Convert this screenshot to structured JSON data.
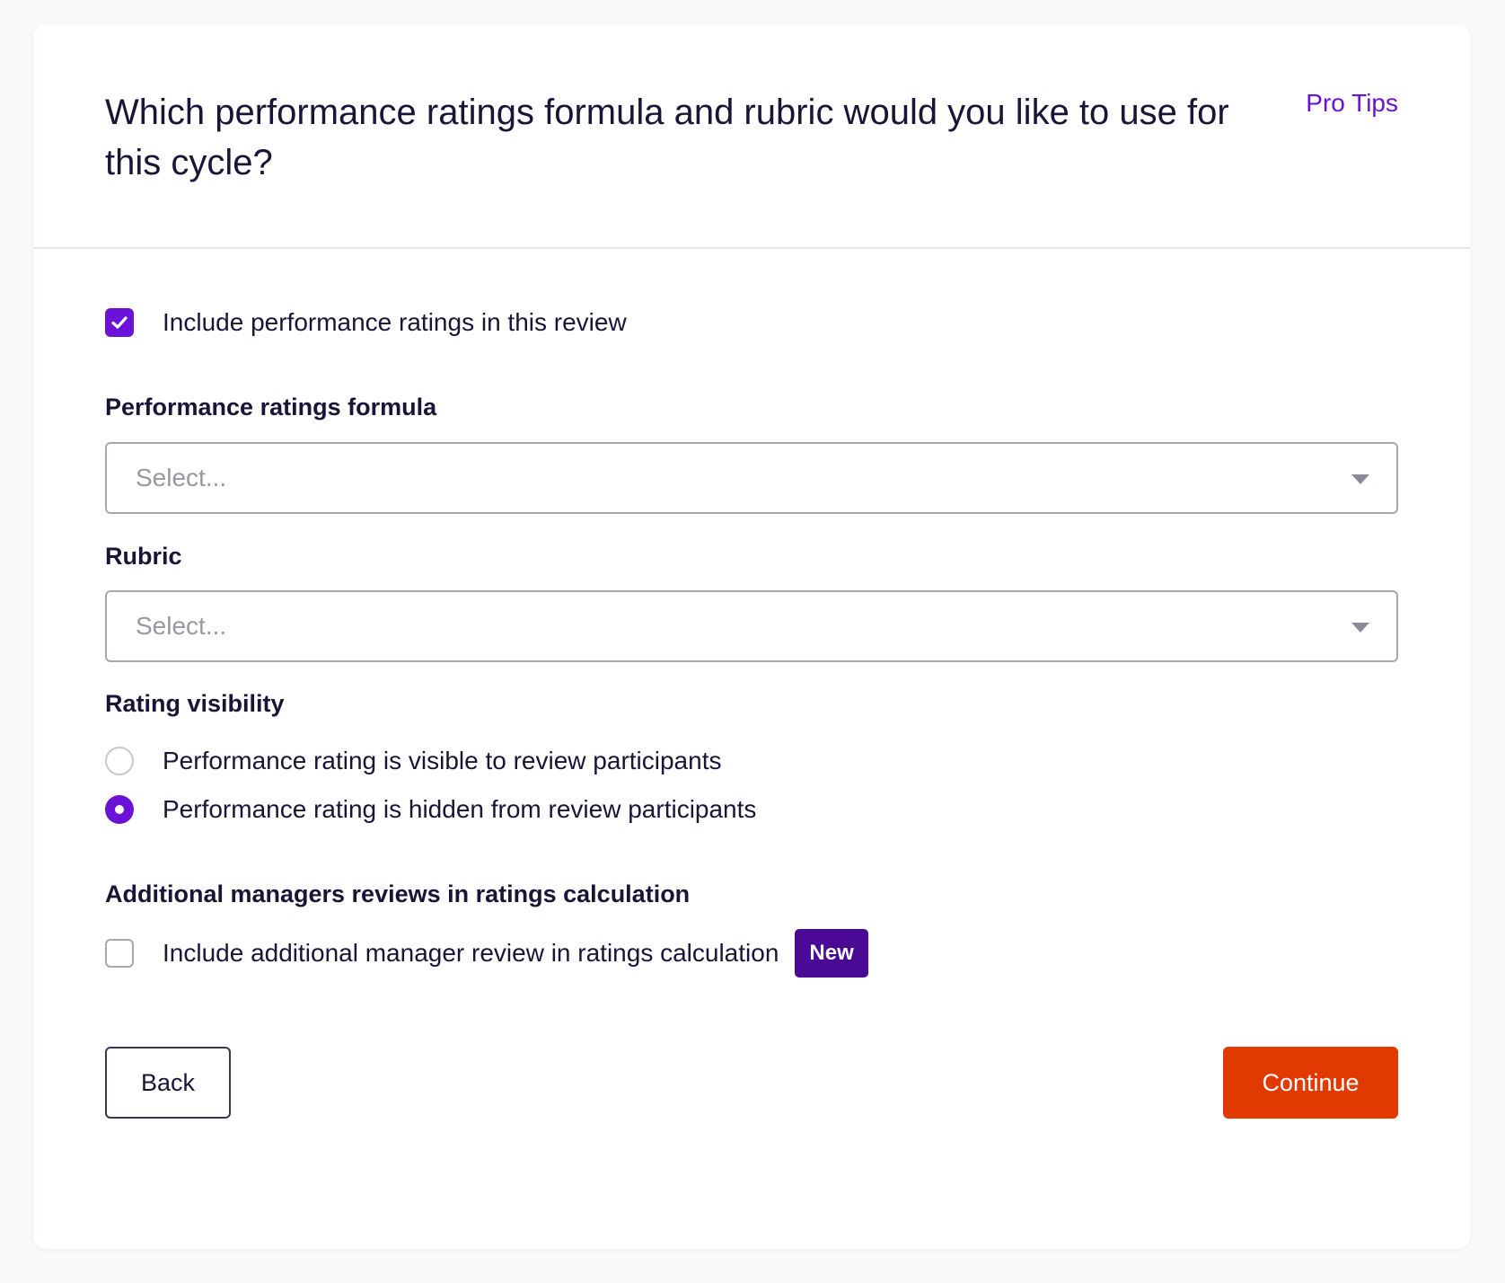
{
  "header": {
    "title": "Which performance ratings formula and rubric would you like to use for this cycle?",
    "pro_tips_label": "Pro Tips"
  },
  "include_ratings": {
    "label": "Include performance ratings in this review",
    "checked": true
  },
  "formula": {
    "label": "Performance ratings formula",
    "placeholder": "Select..."
  },
  "rubric": {
    "label": "Rubric",
    "placeholder": "Select..."
  },
  "visibility": {
    "label": "Rating visibility",
    "options": [
      {
        "label": "Performance rating is visible to review participants",
        "selected": false
      },
      {
        "label": "Performance rating is hidden from review participants",
        "selected": true
      }
    ]
  },
  "additional_managers": {
    "label": "Additional managers reviews in ratings calculation",
    "checkbox_label": "Include additional manager review in ratings calculation",
    "checked": false,
    "badge": "New"
  },
  "footer": {
    "back_label": "Back",
    "continue_label": "Continue"
  },
  "colors": {
    "accent": "#6b12d8",
    "badge": "#4a0a96",
    "primary_button": "#e03a00",
    "text": "#1c1437"
  }
}
